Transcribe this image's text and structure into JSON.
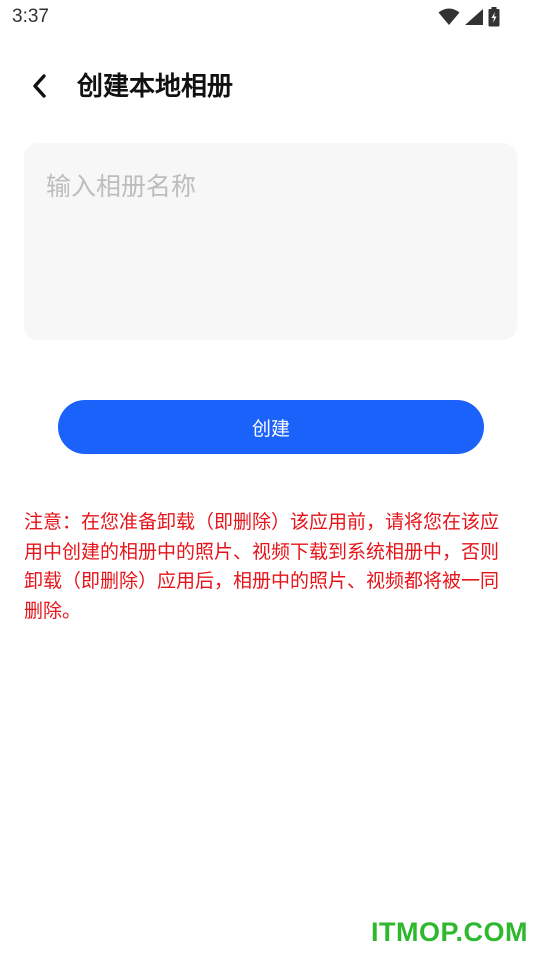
{
  "status_bar": {
    "time": "3:37",
    "icons": [
      "wifi-icon",
      "cell-signal-icon",
      "battery-charging-icon"
    ]
  },
  "header": {
    "back_icon": "chevron-left-icon",
    "title": "创建本地相册"
  },
  "form": {
    "name_input": {
      "value": "",
      "placeholder": "输入相册名称"
    },
    "create_label": "创建"
  },
  "notice": {
    "text": "注意：在您准备卸载（即删除）该应用前，请将您在该应用中创建的相册中的照片、视频下载到系统相册中，否则卸载（即删除）应用后，相册中的照片、视频都将被一同删除。"
  },
  "watermark": {
    "text": "ITMOP.COM"
  },
  "colors": {
    "accent": "#1b62fb",
    "notice": "#e5141a",
    "input_bg": "#f7f7f7",
    "placeholder": "#bdbdbd",
    "watermark": "#2eb82e"
  }
}
